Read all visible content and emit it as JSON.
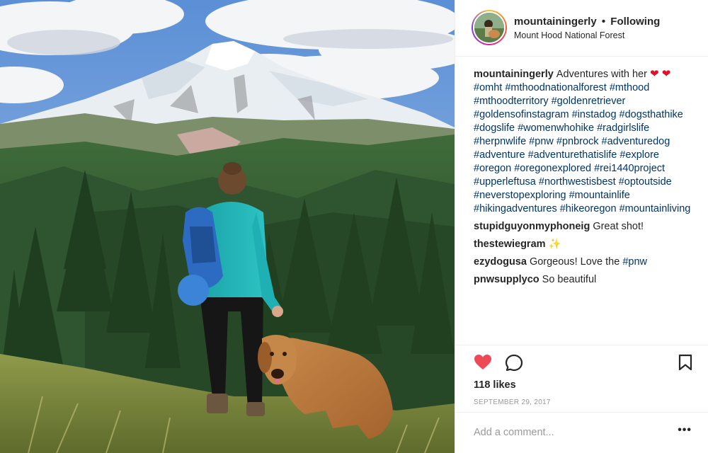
{
  "post": {
    "username": "mountainingerly",
    "separator": "•",
    "follow_status": "Following",
    "location": "Mount Hood National Forest",
    "photo_alt": "Hiker with a blue backpack and a golden retriever looking at snow-capped Mount Hood",
    "caption_text": "Adventures with her",
    "caption_emoji": "❤ ❤",
    "hashtags": "#omht #mthoodnationalforest #mthood #mthoodterritory #goldenretriever #goldensofinstagram #instadog #dogsthathike #dogslife #womenwhohike #radgirlslife #herpnwlife #pnw #pnbrock #adventuredog #adventure #adventurethatislife #explore #oregon #oregonexplored #rei1440project #upperleftusa #northwestisbest #optoutside #neverstopexploring #mountainlife #hikingadventures #hikeoregon #mountainliving",
    "likes": "118 likes",
    "date": "September 29, 2017"
  },
  "comments": [
    {
      "user": "stupidguyonmyphoneig",
      "text": "Great shot!"
    },
    {
      "user": "thestewiegram",
      "text": "✨"
    },
    {
      "user": "ezydogusa",
      "text": "Gorgeous! Love the",
      "tag": "#pnw"
    },
    {
      "user": "pnwsupplyco",
      "text": "So beautiful"
    }
  ],
  "add_comment": {
    "placeholder": "Add a comment..."
  },
  "more_label": "•••",
  "icons": {
    "like": "heart-filled-icon",
    "comment": "comment-bubble-icon",
    "save": "bookmark-icon"
  },
  "colors": {
    "like_red": "#ed4956",
    "link_blue": "#003569",
    "meta_gray": "#999999",
    "text": "#262626"
  }
}
